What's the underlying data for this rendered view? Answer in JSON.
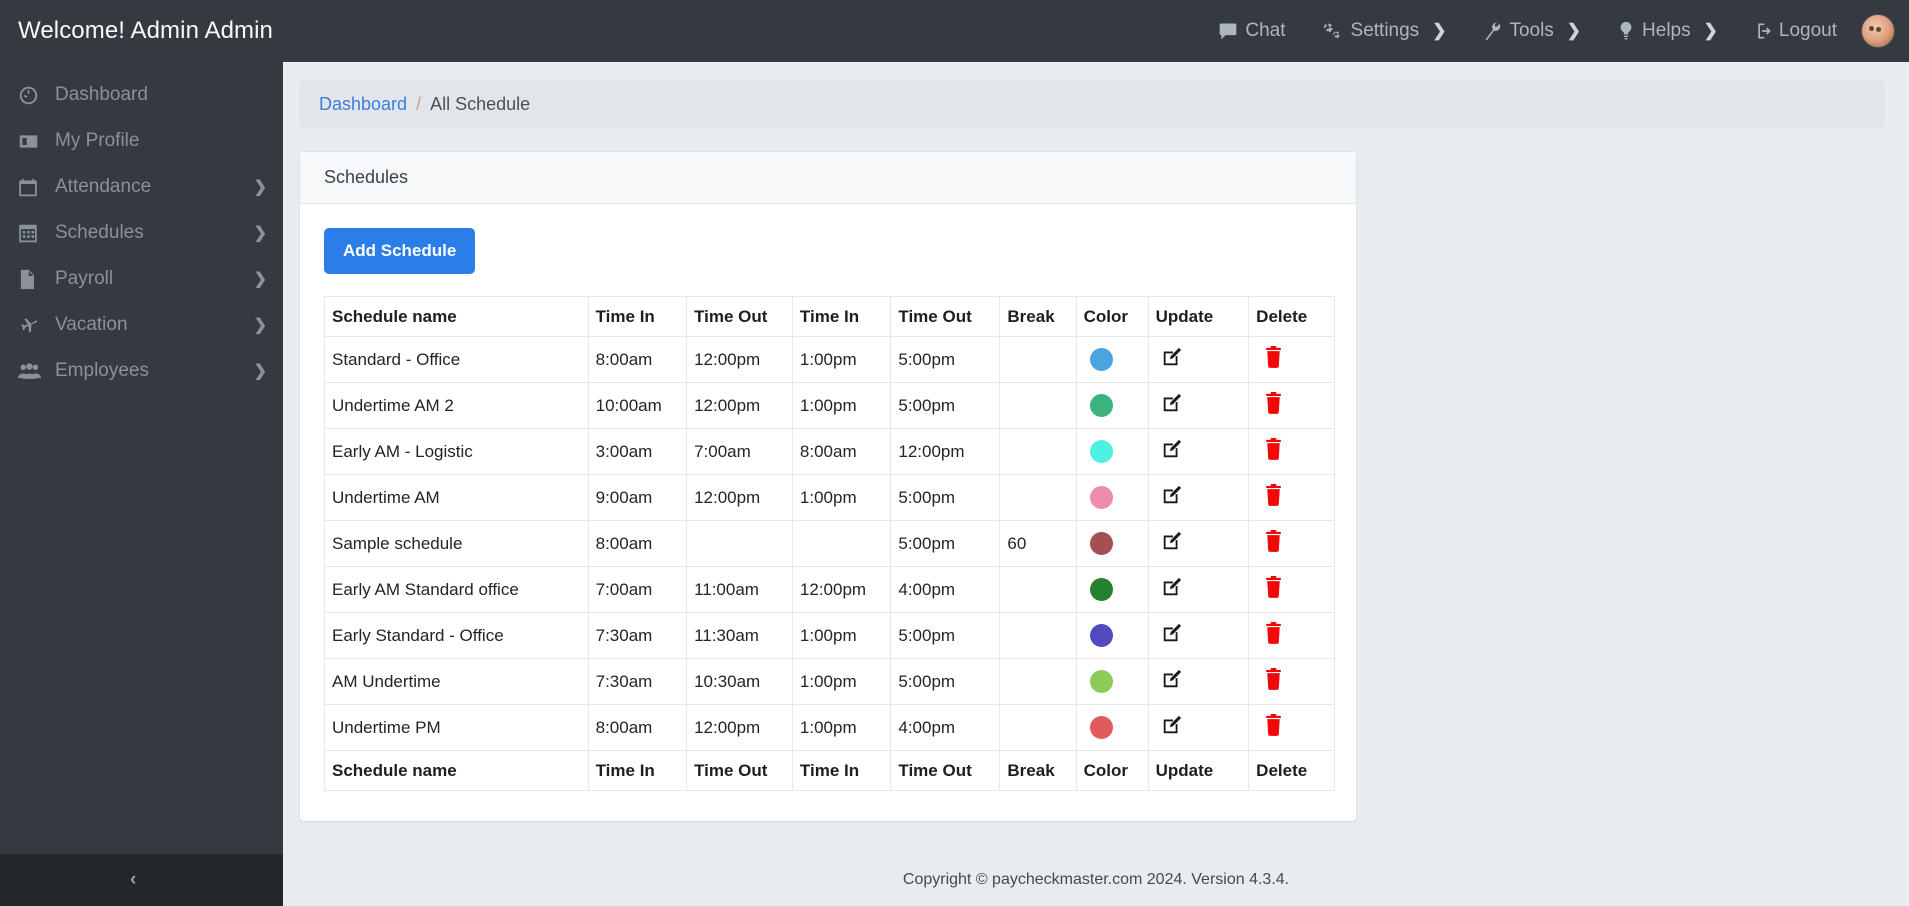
{
  "header": {
    "brand": "Welcome! Admin Admin",
    "nav": [
      {
        "label": "Chat",
        "icon": "chat-icon",
        "caret": ""
      },
      {
        "label": "Settings",
        "icon": "gears-icon",
        "caret": "❯"
      },
      {
        "label": "Tools",
        "icon": "wrench-icon",
        "caret": "❯"
      },
      {
        "label": "Helps",
        "icon": "lightbulb-icon",
        "caret": "❯"
      },
      {
        "label": "Logout",
        "icon": "logout-icon",
        "caret": ""
      }
    ],
    "avatar_name": "user-avatar"
  },
  "sidebar": {
    "items": [
      {
        "label": "Dashboard",
        "icon": "gauge-icon",
        "caret": ""
      },
      {
        "label": "My Profile",
        "icon": "id-card-icon",
        "caret": ""
      },
      {
        "label": "Attendance",
        "icon": "calendar-icon",
        "caret": "❯"
      },
      {
        "label": "Schedules",
        "icon": "calendar-grid-icon",
        "caret": "❯"
      },
      {
        "label": "Payroll",
        "icon": "file-icon",
        "caret": "❯"
      },
      {
        "label": "Vacation",
        "icon": "plane-icon",
        "caret": "❯"
      },
      {
        "label": "Employees",
        "icon": "users-icon",
        "caret": "❯"
      }
    ],
    "collapse_icon": "‹"
  },
  "breadcrumb": {
    "root": "Dashboard",
    "separator": "/",
    "current": "All Schedule"
  },
  "card": {
    "title": "Schedules",
    "add_button": "Add Schedule"
  },
  "table": {
    "columns": [
      "Schedule name",
      "Time In",
      "Time Out",
      "Time In",
      "Time Out",
      "Break",
      "Color",
      "Update",
      "Delete"
    ],
    "rows": [
      {
        "name": "Standard - Office",
        "in1": "8:00am",
        "out1": "12:00pm",
        "in2": "1:00pm",
        "out2": "5:00pm",
        "break": "",
        "color": "#49a4e0"
      },
      {
        "name": "Undertime AM 2",
        "in1": "10:00am",
        "out1": "12:00pm",
        "in2": "1:00pm",
        "out2": "5:00pm",
        "break": "",
        "color": "#3cb37e"
      },
      {
        "name": "Early AM - Logistic",
        "in1": "3:00am",
        "out1": "7:00am",
        "in2": "8:00am",
        "out2": "12:00pm",
        "break": "",
        "color": "#4ff0e4"
      },
      {
        "name": "Undertime AM",
        "in1": "9:00am",
        "out1": "12:00pm",
        "in2": "1:00pm",
        "out2": "5:00pm",
        "break": "",
        "color": "#ef8bac"
      },
      {
        "name": "Sample schedule",
        "in1": "8:00am",
        "out1": "",
        "in2": "",
        "out2": "5:00pm",
        "break": "60",
        "color": "#a44f53"
      },
      {
        "name": "Early AM Standard office",
        "in1": "7:00am",
        "out1": "11:00am",
        "in2": "12:00pm",
        "out2": "4:00pm",
        "break": "",
        "color": "#258030"
      },
      {
        "name": "Early Standard - Office",
        "in1": "7:30am",
        "out1": "11:30am",
        "in2": "1:00pm",
        "out2": "5:00pm",
        "break": "",
        "color": "#5248c0"
      },
      {
        "name": "AM Undertime",
        "in1": "7:30am",
        "out1": "10:30am",
        "in2": "1:00pm",
        "out2": "5:00pm",
        "break": "",
        "color": "#8ccc56"
      },
      {
        "name": "Undertime PM",
        "in1": "8:00am",
        "out1": "12:00pm",
        "in2": "1:00pm",
        "out2": "4:00pm",
        "break": "",
        "color": "#e05a5e"
      }
    ],
    "update_icon": "edit-pencil-icon",
    "delete_icon": "trash-icon",
    "delete_color": "#f40707"
  },
  "footer": {
    "text": "Copyright © paycheckmaster.com 2024. Version 4.3.4."
  },
  "theme": {
    "dark": "#343a40",
    "accent": "#2b7de9",
    "link": "#3b7ddd",
    "page_bg": "#e9ecef"
  }
}
